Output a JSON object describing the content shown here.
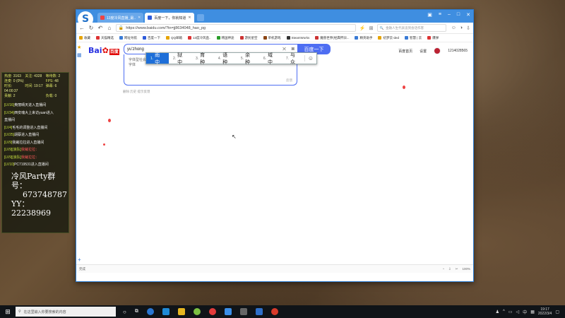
{
  "overlay": {
    "stats": [
      {
        "label": "热度:",
        "value": "3163"
      },
      {
        "label": "关注:",
        "value": "4328"
      },
      {
        "label": "等待数:",
        "value": "2"
      },
      {
        "label": "连麦:",
        "value": "0 (0%)"
      },
      {
        "label": "",
        "value": ""
      },
      {
        "label": "FPS:",
        "value": "48"
      },
      {
        "label": "时长:",
        "value": "04:00:37"
      },
      {
        "label": "时间:",
        "value": "19:17"
      },
      {
        "label": "弹幕:",
        "value": "6"
      },
      {
        "label": "贡献:",
        "value": "2"
      },
      {
        "label": "",
        "value": ""
      },
      {
        "label": "负载:",
        "value": "0"
      }
    ],
    "chat": [
      {
        "lv": "[LV16]",
        "msg": "奥丽晴天进入直播间",
        "red": false
      },
      {
        "lv": "[LV34]",
        "msg": "西安魂大上来访yuan进入",
        "red": false
      },
      {
        "lv": "",
        "msg": "直播间",
        "red": false
      },
      {
        "lv": "[LV4]",
        "msg": "毛毛的调整进入直播间",
        "red": false
      },
      {
        "lv": "[LV25]",
        "msg": "胡蔡进入直播间",
        "red": false
      },
      {
        "lv": "[LV9]",
        "msg": "我裁拉拉进入直播间",
        "red": false
      },
      {
        "lv": "[LV9][浪队]",
        "msg": "我裁拉拉：",
        "red": true
      },
      {
        "lv": "[LV9][浪队]",
        "msg": "我裁拉拉：",
        "red": true
      },
      {
        "lv": "[LV10]",
        "msg": "PC719531进入直播间",
        "red": false
      }
    ],
    "party_title": "冷风Party群号：",
    "party_number": "673748787",
    "yy_label": "YY：22238969"
  },
  "browser": {
    "tabs": [
      {
        "label": "13度冷风直播_最..",
        "fav": "red",
        "active": false
      },
      {
        "label": "百度一下，你就知道",
        "fav": "blue",
        "active": true
      }
    ],
    "url": "https://www.baidu.com/?tn=jj8634048_hao_pg",
    "side_search_placeholder": "金融人生代表追到会话作客",
    "bookmarks": [
      "收藏",
      "天猫精选",
      "网址导航",
      "百度一下",
      "QQ邮箱",
      "13度冷风直..",
      "韩国神途",
      "游民星空",
      "单机游戏",
      "SteamWorks",
      "魔兽世界(经典怀旧...",
      "精英助手",
      "初梦云-ded",
      "智慧 | 云",
      "爆弹"
    ],
    "status_left": "完成",
    "zoom": "100%"
  },
  "baidu": {
    "logo_text": "Bai",
    "logo_badge": "百度",
    "search_value": "yu'zhong",
    "search_button": "百度一下",
    "top_links": [
      "百度首页",
      "设置"
    ],
    "username": "1214028565",
    "suggest_rows": [
      "字体型社会...",
      "字体"
    ],
    "suggest_footer": "反馈",
    "feedback_text": "删除 历史 提示反馈",
    "ime_candidates": [
      {
        "num": "1.",
        "text": "雨中"
      },
      {
        "num": "2.",
        "text": "狱中"
      },
      {
        "num": "3.",
        "text": "育种"
      },
      {
        "num": "4.",
        "text": "语种"
      },
      {
        "num": "5.",
        "text": "余种"
      },
      {
        "num": "6.",
        "text": "域中"
      },
      {
        "num": "7.",
        "text": "与众"
      }
    ]
  },
  "taskbar": {
    "search_placeholder": "在这里输入你要搜索的内容",
    "time": "19:17",
    "date": "2022/3/4",
    "ime": "中"
  }
}
